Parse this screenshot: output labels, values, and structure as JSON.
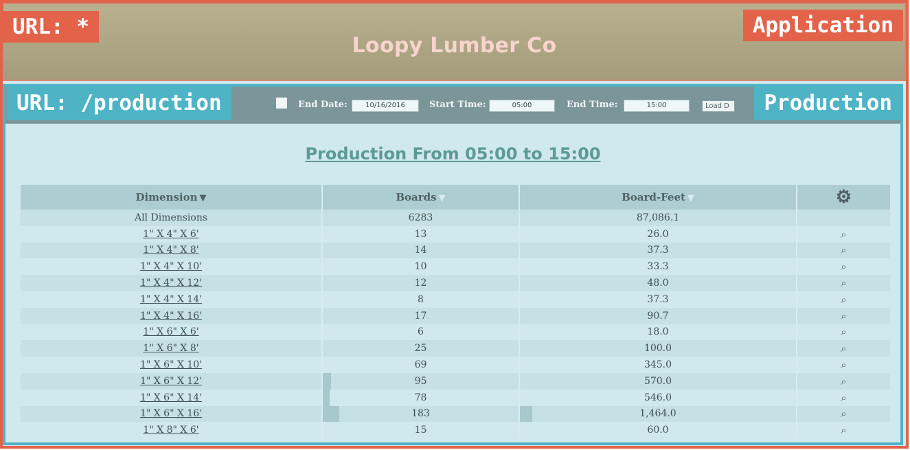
{
  "annotations": {
    "url_app": "URL: *",
    "application": "Application",
    "url_production": "URL: /production",
    "production": "Production"
  },
  "app": {
    "title": "Loopy Lumber Co"
  },
  "toolbar": {
    "end_date_label": "End Date:",
    "end_date_value": "10/16/2016",
    "start_time_label": "Start Time:",
    "start_time_value": "05:00",
    "end_time_label": "End Time:",
    "end_time_value": "15:00",
    "load_button": "Load D"
  },
  "report": {
    "title": "Production From 05:00 to 15:00",
    "columns": [
      "Dimension",
      "Boards",
      "Board-Feet"
    ],
    "sort_active": "▼",
    "sort_inactive": "▼",
    "settings_icon": "gears-icon",
    "rows": [
      {
        "dimension": "All Dimensions",
        "boards": "6283",
        "board_feet": "87,086.1",
        "link": false
      },
      {
        "dimension": "1\" X 4\" X 6'",
        "boards": "13",
        "board_feet": "26.0",
        "link": true
      },
      {
        "dimension": "1\" X 4\" X 8'",
        "boards": "14",
        "board_feet": "37.3",
        "link": true
      },
      {
        "dimension": "1\" X 4\" X 10'",
        "boards": "10",
        "board_feet": "33.3",
        "link": true
      },
      {
        "dimension": "1\" X 4\" X 12'",
        "boards": "12",
        "board_feet": "48.0",
        "link": true
      },
      {
        "dimension": "1\" X 4\" X 14'",
        "boards": "8",
        "board_feet": "37.3",
        "link": true
      },
      {
        "dimension": "1\" X 4\" X 16'",
        "boards": "17",
        "board_feet": "90.7",
        "link": true
      },
      {
        "dimension": "1\" X 6\" X 6'",
        "boards": "6",
        "board_feet": "18.0",
        "link": true
      },
      {
        "dimension": "1\" X 6\" X 8'",
        "boards": "25",
        "board_feet": "100.0",
        "link": true
      },
      {
        "dimension": "1\" X 6\" X 10'",
        "boards": "69",
        "board_feet": "345.0",
        "link": true
      },
      {
        "dimension": "1\" X 6\" X 12'",
        "boards": "95",
        "board_feet": "570.0",
        "link": true
      },
      {
        "dimension": "1\" X 6\" X 14'",
        "boards": "78",
        "board_feet": "546.0",
        "link": true
      },
      {
        "dimension": "1\" X 6\" X 16'",
        "boards": "183",
        "board_feet": "1,464.0",
        "link": true
      },
      {
        "dimension": "1\" X 8\" X 6'",
        "boards": "15",
        "board_feet": "60.0",
        "link": true
      }
    ]
  },
  "colors": {
    "application_frame": "#e2634a",
    "production_frame": "#4fb3c6"
  }
}
